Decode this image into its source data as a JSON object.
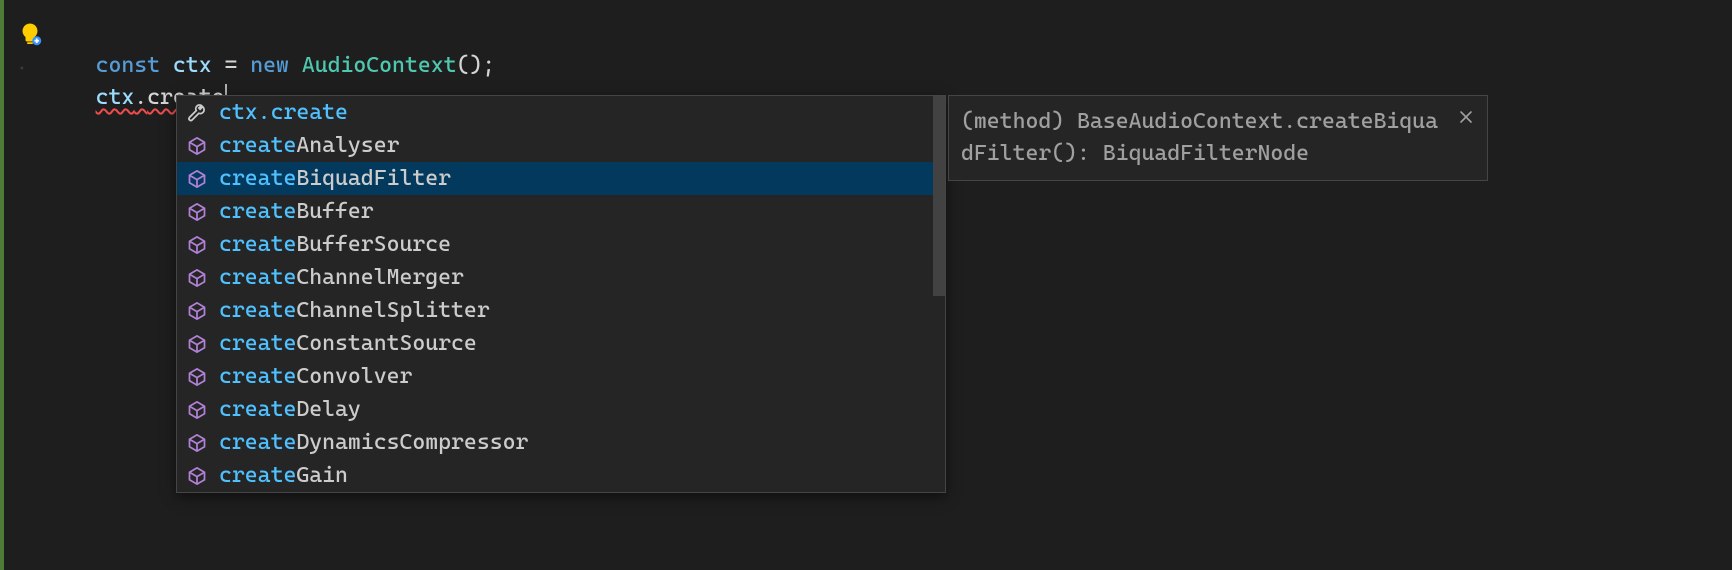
{
  "code": {
    "line1": {
      "kw_const": "const",
      "var_ctx": "ctx",
      "op_eq": "=",
      "kw_new": "new",
      "type_audiocontext": "AudioContext",
      "parens_semi": "();"
    },
    "line2": {
      "var_ctx": "ctx",
      "dot": ".",
      "member": "create"
    }
  },
  "suggest": {
    "prefix": "create",
    "items": [
      {
        "icon": "wrench",
        "match": "ctx.create",
        "rest": "",
        "selected": false
      },
      {
        "icon": "method",
        "match": "create",
        "rest": "Analyser",
        "selected": false
      },
      {
        "icon": "method",
        "match": "create",
        "rest": "BiquadFilter",
        "selected": true
      },
      {
        "icon": "method",
        "match": "create",
        "rest": "Buffer",
        "selected": false
      },
      {
        "icon": "method",
        "match": "create",
        "rest": "BufferSource",
        "selected": false
      },
      {
        "icon": "method",
        "match": "create",
        "rest": "ChannelMerger",
        "selected": false
      },
      {
        "icon": "method",
        "match": "create",
        "rest": "ChannelSplitter",
        "selected": false
      },
      {
        "icon": "method",
        "match": "create",
        "rest": "ConstantSource",
        "selected": false
      },
      {
        "icon": "method",
        "match": "create",
        "rest": "Convolver",
        "selected": false
      },
      {
        "icon": "method",
        "match": "create",
        "rest": "Delay",
        "selected": false
      },
      {
        "icon": "method",
        "match": "create",
        "rest": "DynamicsCompressor",
        "selected": false
      },
      {
        "icon": "method",
        "match": "create",
        "rest": "Gain",
        "selected": false
      }
    ]
  },
  "details": {
    "text": "(method) BaseAudioContext.createBiquadFilter(): BiquadFilterNode"
  },
  "colors": {
    "keyword": "#569cd6",
    "variable": "#9cdcfe",
    "type": "#4ec9b0",
    "match": "#4fc1ff",
    "selection": "#04395e",
    "border_accent": "#4e7c37",
    "method_icon": "#b180d7",
    "wrench_icon": "#cccccc"
  }
}
